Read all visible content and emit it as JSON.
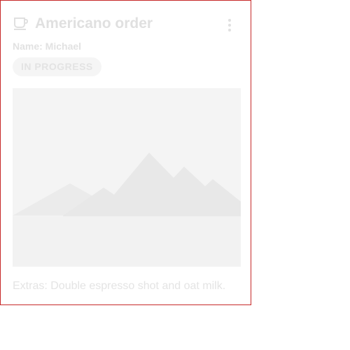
{
  "card": {
    "title": "Americano order",
    "title_icon": "coffee-cup-icon",
    "menu_icon": "more-vert-icon",
    "name_line": "Name: Michael",
    "status": "IN PROGRESS",
    "image_icon": "image-placeholder-mountains",
    "extras_line": "Extras: Double espresso shot and oat milk."
  },
  "colors": {
    "border": "#c62828",
    "muted_text": "#e0e0e0",
    "badge_bg": "#f5f5f5",
    "image_bg": "#f5f5f5"
  }
}
